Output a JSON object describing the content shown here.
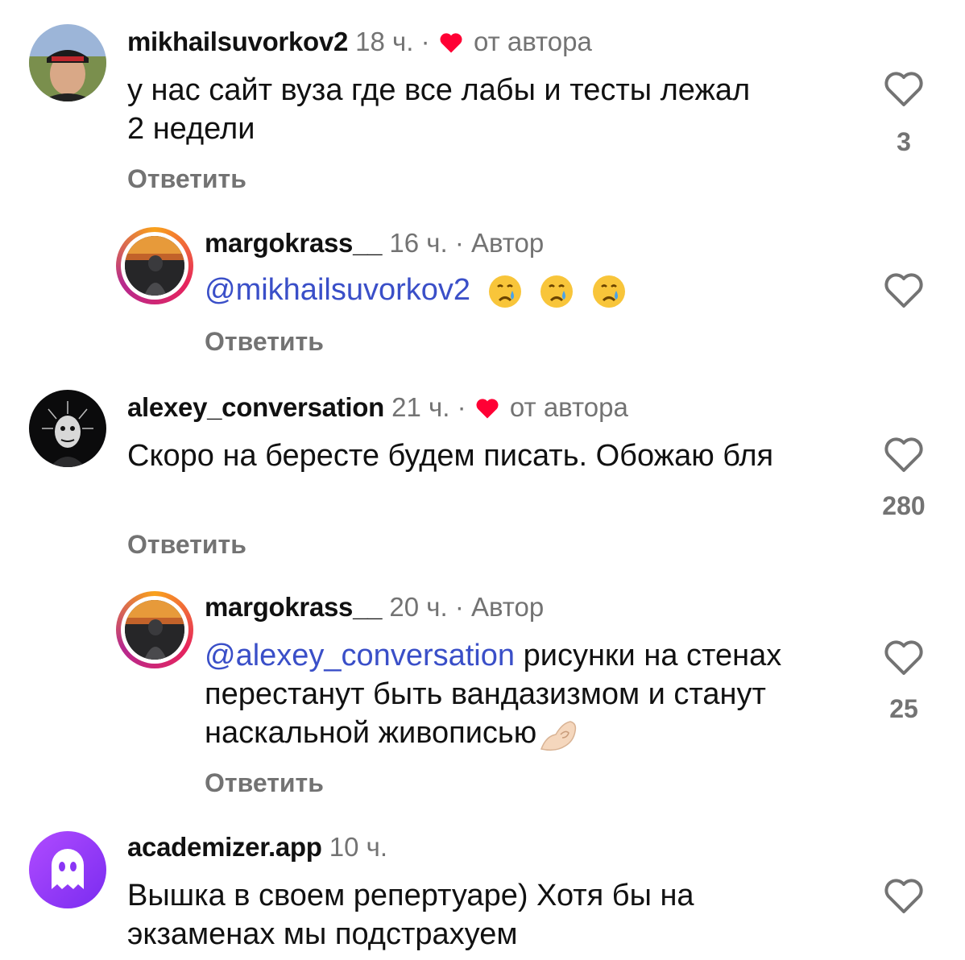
{
  "reply_label": "Ответить",
  "colors": {
    "meta_gray": "#737373",
    "mention_blue": "#3a4fc8",
    "heart_red": "#ff0034"
  },
  "comments": [
    {
      "username": "mikhailsuvorkov2",
      "time": "18 ч.",
      "separator": "·",
      "liked_by_author": true,
      "author_tag": "от автора",
      "text": "у нас сайт вуза где все лабы и тесты лежал 2 недели",
      "likes": "3",
      "reply": "Ответить"
    },
    {
      "username": "margokrass__",
      "time": "16 ч.",
      "separator": "·",
      "author_tag": "Автор",
      "mention": "@mikhailsuvorkov2",
      "emoji": "crying-face-emoji x3",
      "reply": "Ответить"
    },
    {
      "username": "alexey_conversation",
      "time": "21 ч.",
      "separator": "·",
      "liked_by_author": true,
      "author_tag": "от автора",
      "text": "Скоро на бересте будем писать. Обожаю бля",
      "likes": "280",
      "reply": "Ответить"
    },
    {
      "username": "margokrass__",
      "time": "20 ч.",
      "separator": "·",
      "author_tag": "Автор",
      "mention": "@alexey_conversation",
      "text": "рисунки на стенах перестанут быть вандазизмом и станут наскальной живописью",
      "emoji": "pinching-hand-emoji",
      "likes": "25",
      "reply": "Ответить"
    },
    {
      "username": "academizer.app",
      "time": "10 ч.",
      "text": "Вышка в своем репертуаре) Хотя бы на экзаменах мы подстрахуем"
    }
  ]
}
